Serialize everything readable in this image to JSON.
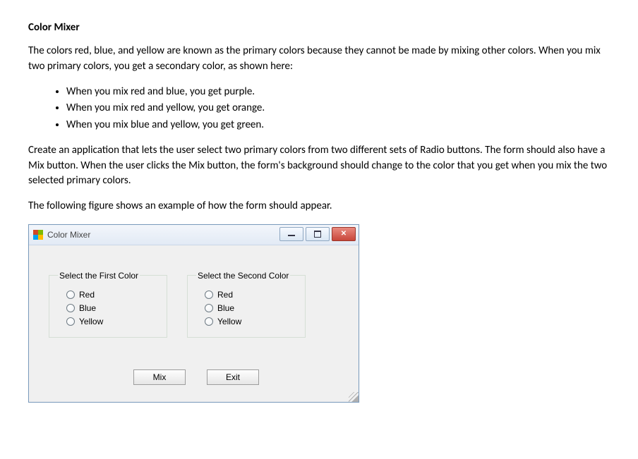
{
  "doc": {
    "title": "Color Mixer",
    "para1": "The colors red, blue, and yellow are known as the primary colors because they cannot be made by mixing other colors. When you mix two primary colors, you get a secondary color, as shown here:",
    "bullets": [
      "When you mix red and blue, you get purple.",
      "When you mix red and yellow, you get orange.",
      "When you mix blue and yellow, you get green."
    ],
    "para2": "Create an application that lets the user select two primary colors from two different sets of  Radio buttons. The form should also have a  Mix  button. When the user clicks the  Mix  button, the form's background should change to the color that you get when you mix the two selected primary colors.",
    "para3": "The following figure shows an example of how the form should appear."
  },
  "app": {
    "window_title": "Color Mixer",
    "group1": {
      "legend": "Select the First Color",
      "options": [
        "Red",
        "Blue",
        "Yellow"
      ]
    },
    "group2": {
      "legend": "Select the Second Color",
      "options": [
        "Red",
        "Blue",
        "Yellow"
      ]
    },
    "buttons": {
      "mix": "Mix",
      "exit": "Exit"
    }
  }
}
